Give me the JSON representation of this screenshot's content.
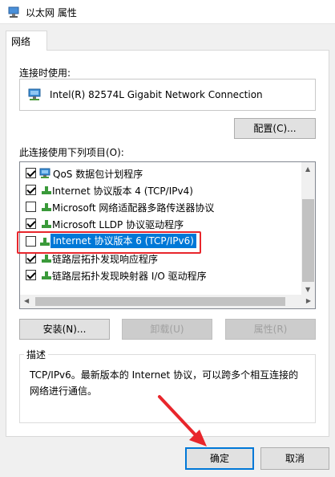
{
  "window": {
    "title": "以太网 属性"
  },
  "tabs": [
    {
      "label": "网络"
    }
  ],
  "connect_using": {
    "label": "连接时使用:",
    "adapter": "Intel(R) 82574L Gigabit Network Connection",
    "configure_button": "配置(C)..."
  },
  "items_section": {
    "label": "此连接使用下列项目(O):",
    "items": [
      {
        "label": "QoS 数据包计划程序",
        "checked": true
      },
      {
        "label": "Internet 协议版本 4 (TCP/IPv4)",
        "checked": true
      },
      {
        "label": "Microsoft 网络适配器多路传送器协议",
        "checked": false
      },
      {
        "label": "Microsoft LLDP 协议驱动程序",
        "checked": true
      },
      {
        "label": "Internet 协议版本 6 (TCP/IPv6)",
        "checked": false,
        "selected": true
      },
      {
        "label": "链路层拓扑发现响应程序",
        "checked": true
      },
      {
        "label": "链路层拓扑发现映射器 I/O 驱动程序",
        "checked": true
      }
    ]
  },
  "actions": {
    "install": "安装(N)...",
    "uninstall": "卸载(U)",
    "properties": "属性(R)"
  },
  "description": {
    "title": "描述",
    "text": "TCP/IPv6。最新版本的 Internet 协议，可以跨多个相互连接的网络进行通信。"
  },
  "footer": {
    "ok": "确定",
    "cancel": "取消"
  },
  "colors": {
    "accent": "#0078d7",
    "highlight_box": "#e8262c",
    "annotation_arrow": "#e8262c"
  }
}
